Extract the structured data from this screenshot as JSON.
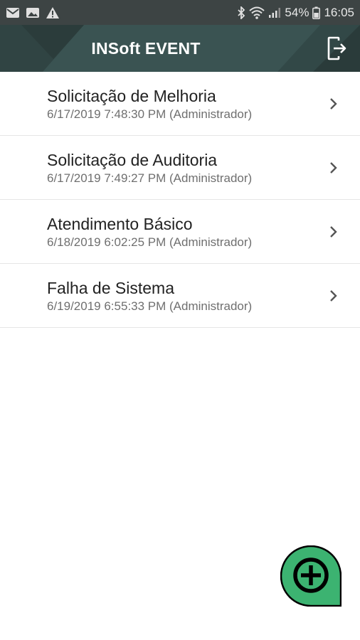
{
  "status_bar": {
    "left_icons": [
      "mail-icon",
      "image-icon",
      "warning-icon"
    ],
    "right_icons": [
      "bluetooth-icon",
      "wifi-icon",
      "signal-icon",
      "battery-icon"
    ],
    "battery": "54%",
    "time": "16:05"
  },
  "header": {
    "title": "INSoft EVENT",
    "logout_icon": "logout-icon"
  },
  "events": [
    {
      "title": "Solicitação de Melhoria",
      "subtitle": "6/17/2019 7:48:30 PM (Administrador)"
    },
    {
      "title": "Solicitação de Auditoria",
      "subtitle": "6/17/2019 7:49:27 PM (Administrador)"
    },
    {
      "title": "Atendimento Básico",
      "subtitle": "6/18/2019 6:02:25 PM (Administrador)"
    },
    {
      "title": "Falha de Sistema",
      "subtitle": "6/19/2019 6:55:33 PM (Administrador)"
    }
  ],
  "fab": {
    "icon": "add-icon",
    "color": "#3cb371"
  },
  "colors": {
    "status_bar": "#3d4444",
    "app_bar": "#3a5352",
    "fab_green": "#3cb371"
  }
}
